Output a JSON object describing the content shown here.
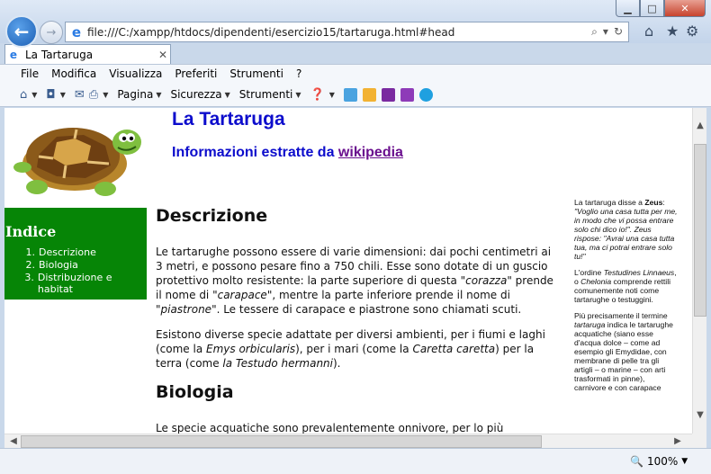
{
  "browser": {
    "address": "file:///C:/xampp/htdocs/dipendenti/esercizio15/tartaruga.html#head",
    "tab_title": "La Tartaruga",
    "menu": [
      "File",
      "Modifica",
      "Visualizza",
      "Preferiti",
      "Strumenti",
      "?"
    ],
    "command_bar": {
      "pagina": "Pagina",
      "sicurezza": "Sicurezza",
      "strumenti": "Strumenti"
    },
    "zoom": "100%"
  },
  "page": {
    "title": "La Tartaruga",
    "subtitle_prefix": "Informazioni estratte da ",
    "subtitle_link": "wikipedia",
    "index": {
      "heading": "Indice",
      "items": [
        {
          "num": "1.",
          "label": "Descrizione"
        },
        {
          "num": "2.",
          "label": "Biologia"
        },
        {
          "num": "3.",
          "label": "Distribuzione e habitat"
        }
      ]
    },
    "sections": {
      "descrizione_title": "Descrizione",
      "descrizione_p1_a": "Le tartarughe possono essere di varie dimensioni: dai pochi centimetri ai 3 metri, e possono pesare fino a 750 chili. Esse sono dotate di un guscio protettivo molto resistente: la parte superiore di questa \"",
      "descrizione_p1_b": "corazza",
      "descrizione_p1_c": "\" prende il nome di \"",
      "descrizione_p1_d": "carapace",
      "descrizione_p1_e": "\", mentre la parte inferiore prende il nome di \"",
      "descrizione_p1_f": "piastrone",
      "descrizione_p1_g": "\". Le tessere di carapace e piastrone sono chiamati scuti.",
      "descrizione_p2_a": "Esistono diverse specie adattate per diversi ambienti, per i fiumi e laghi (come la ",
      "descrizione_p2_b": "Emys orbicularis",
      "descrizione_p2_c": "), per i mari (come la ",
      "descrizione_p2_d": "Caretta caretta",
      "descrizione_p2_e": ") per la terra (come ",
      "descrizione_p2_f": "la Testudo hermanni",
      "descrizione_p2_g": ").",
      "biologia_title": "Biologia",
      "biologia_p1": "Le specie acquatiche sono prevalentemente onnivore, per lo più carnivore da"
    },
    "sidebar": {
      "p1_a": "La tartaruga disse a ",
      "p1_b": "Zeus",
      "p1_c": ":",
      "p1_quote": "\"Voglio una casa tutta per me, in modo che vi possa entrare solo chi dico io!\". Zeus rispose: \"Avrai una casa tutta tua, ma ci potrai entrare solo tu!\"",
      "p2_a": "L'ordine ",
      "p2_b": "Testudines Linnaeus",
      "p2_c": ", o ",
      "p2_d": "Chelonia",
      "p2_e": " comprende rettili comunemente noti come tartarughe o testuggini.",
      "p3_a": "Più precisamente il termine ",
      "p3_b": "tartaruga",
      "p3_c": " indica le tartarughe acquatiche (siano esse d'acqua dolce – come ad esempio gli Emydidae, con membrane di pelle tra gli artigli – o marine – con arti trasformati in pinne), carnivore e con carapace"
    }
  }
}
